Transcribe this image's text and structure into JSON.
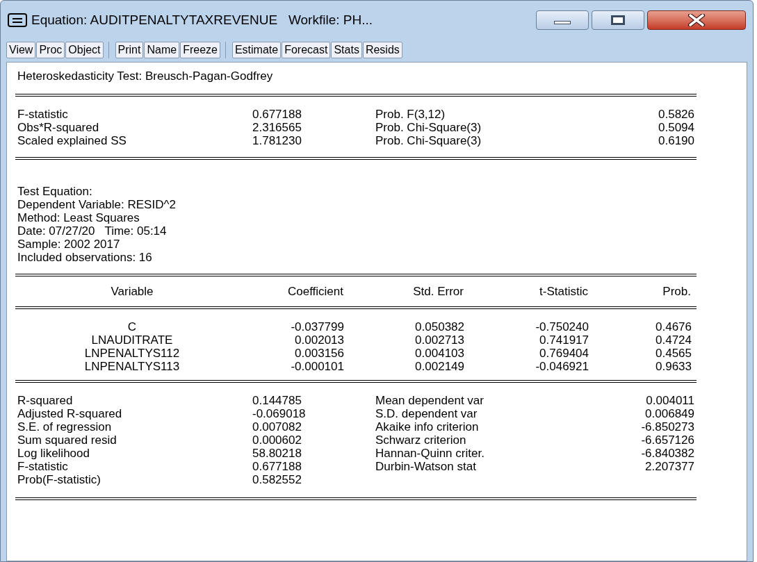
{
  "window": {
    "title": "Equation: AUDITPENALTYTAXREVENUE   Workfile: PH..."
  },
  "toolbar": [
    [
      "View",
      "Proc",
      "Object"
    ],
    [
      "Print",
      "Name",
      "Freeze"
    ],
    [
      "Estimate",
      "Forecast",
      "Stats",
      "Resids"
    ]
  ],
  "test_title": "Heteroskedasticity Test: Breusch-Pagan-Godfrey",
  "test_stats": [
    {
      "label": "F-statistic",
      "value": "0.677188",
      "prob_label": "Prob. F(3,12)",
      "prob_value": "0.5826"
    },
    {
      "label": "Obs*R-squared",
      "value": "2.316565",
      "prob_label": "Prob. Chi-Square(3)",
      "prob_value": "0.5094"
    },
    {
      "label": "Scaled explained SS",
      "value": "1.781230",
      "prob_label": "Prob. Chi-Square(3)",
      "prob_value": "0.6190"
    }
  ],
  "test_equation_info": [
    "Test Equation:",
    "Dependent Variable: RESID^2",
    "Method: Least Squares",
    "Date: 07/27/20   Time: 05:14",
    "Sample: 2002 2017",
    "Included observations: 16"
  ],
  "coefficient_table": {
    "columns": [
      "Variable",
      "Coefficient",
      "Std. Error",
      "t-Statistic",
      "Prob."
    ],
    "rows": [
      [
        "C",
        "-0.037799",
        "0.050382",
        "-0.750240",
        "0.4676"
      ],
      [
        "LNAUDITRATE",
        "0.002013",
        "0.002713",
        "0.741917",
        "0.4724"
      ],
      [
        "LNPENALTYS112",
        "0.003156",
        "0.004103",
        "0.769404",
        "0.4565"
      ],
      [
        "LNPENALTYS113",
        "-0.000101",
        "0.002149",
        "-0.046921",
        "0.9633"
      ]
    ]
  },
  "summary_stats": [
    {
      "label": "R-squared",
      "value": "0.144785",
      "label_2": "Mean dependent var",
      "value_2": "0.004011"
    },
    {
      "label": "Adjusted R-squared",
      "value": "-0.069018",
      "label_2": "S.D. dependent var",
      "value_2": "0.006849"
    },
    {
      "label": "S.E. of regression",
      "value": "0.007082",
      "label_2": "Akaike info criterion",
      "value_2": "-6.850273"
    },
    {
      "label": "Sum squared resid",
      "value": "0.000602",
      "label_2": "Schwarz criterion",
      "value_2": "-6.657126"
    },
    {
      "label": "Log likelihood",
      "value": "58.80218",
      "label_2": "Hannan-Quinn criter.",
      "value_2": "-6.840382"
    },
    {
      "label": "F-statistic",
      "value": "0.677188",
      "label_2": "Durbin-Watson stat",
      "value_2": "2.207377"
    },
    {
      "label": "Prob(F-statistic)",
      "value": "0.582552"
    }
  ]
}
